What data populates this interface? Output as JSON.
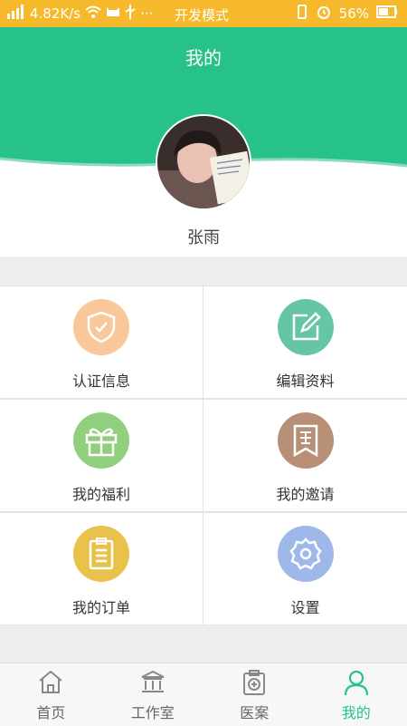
{
  "status_bar": {
    "speed": "4.82K/s",
    "dots": "···",
    "mode": "开发模式",
    "battery": "56%",
    "bg_color": "#f6b92b"
  },
  "header": {
    "title": "我的",
    "bg_color": "#26c28a"
  },
  "profile": {
    "name": "张雨"
  },
  "menu": [
    {
      "label": "认证信息",
      "icon": "shield-check-icon",
      "color": "#f8c89a"
    },
    {
      "label": "编辑资料",
      "icon": "edit-icon",
      "color": "#66c6a4"
    },
    {
      "label": "我的福利",
      "icon": "gift-icon",
      "color": "#8fcf7d"
    },
    {
      "label": "我的邀请",
      "icon": "invite-icon",
      "color": "#b89077"
    },
    {
      "label": "我的订单",
      "icon": "order-clipboard-icon",
      "color": "#e9c24c"
    },
    {
      "label": "设置",
      "icon": "gear-icon",
      "color": "#9fb8ea"
    }
  ],
  "bottom_nav": [
    {
      "label": "首页",
      "icon": "home-icon",
      "active": false
    },
    {
      "label": "工作室",
      "icon": "studio-icon",
      "active": false
    },
    {
      "label": "医案",
      "icon": "medical-record-icon",
      "active": false
    },
    {
      "label": "我的",
      "icon": "user-icon",
      "active": true
    }
  ],
  "accent_color": "#26c28a"
}
